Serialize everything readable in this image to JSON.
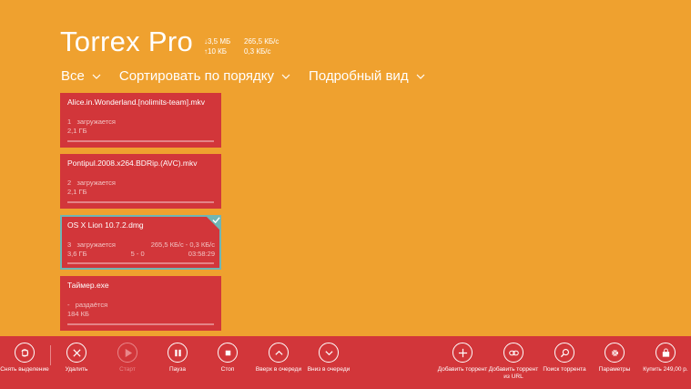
{
  "app": {
    "title": "Torrex Pro",
    "stats": {
      "down_total": "↓3,5 МБ",
      "up_total": "↑10 КБ",
      "down_speed": "265,5 КБ/с",
      "up_speed": "0,3 КБ/с"
    }
  },
  "filters": [
    {
      "label": "Все"
    },
    {
      "label": "Сортировать по порядку"
    },
    {
      "label": "Подробный вид"
    }
  ],
  "torrents": [
    {
      "name": "Alice.in.Wonderland.[nolimits-team].mkv",
      "index": "1",
      "status": "загружается",
      "size": "2,1 ГБ",
      "selected": false
    },
    {
      "name": "Pontipul.2008.x264.BDRip.(AVC).mkv",
      "index": "2",
      "status": "загружается",
      "size": "2,1 ГБ",
      "selected": false
    },
    {
      "name": "OS X Lion 10.7.2.dmg",
      "index": "3",
      "status": "загружается",
      "speed": "265,5 КБ/с - 0,3 КБ/с",
      "size": "3,6 ГБ",
      "peers": "5 - 0",
      "time": "03:58:29",
      "selected": true
    },
    {
      "name": "Таймер.exe",
      "index": "-",
      "status": "раздаётся",
      "size": "184 КБ",
      "selected": false
    }
  ],
  "appbar": {
    "clear_selection": "Снять выделение",
    "delete": "Удалить",
    "start": "Старт",
    "pause": "Пауза",
    "stop": "Стоп",
    "move_up": "Вверх в очереди",
    "move_down": "Вниз в очереди",
    "add_torrent": "Добавить торрент",
    "add_torrent_url": "Добавить торрент из URL",
    "search_torrent": "Поиск торрента",
    "settings": "Параметры",
    "buy": "Купить 249,00 р."
  },
  "colors": {
    "background": "#EFA12F",
    "tile": "#D2363A",
    "selection": "#6FB5B5"
  }
}
